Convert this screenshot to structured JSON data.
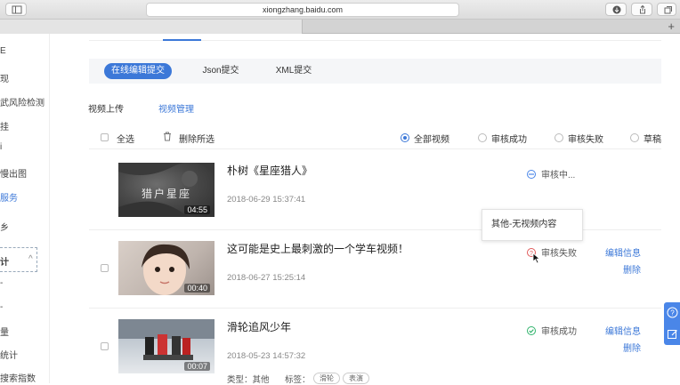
{
  "browser": {
    "url": "xiongzhang.baidu.com",
    "new_tab": "+"
  },
  "sidebar": {
    "items": [
      {
        "label": "E"
      },
      {
        "label": "现"
      },
      {
        "label": "武风险检测"
      },
      {
        "label": "挂"
      },
      {
        "label": "i"
      },
      {
        "label": "慢出图"
      },
      {
        "label": "服务"
      },
      {
        "label": "乡"
      },
      {
        "label": "计"
      },
      {
        "label": "-"
      },
      {
        "label": "-"
      },
      {
        "label": "量"
      },
      {
        "label": "统计"
      },
      {
        "label": "搜索指数"
      }
    ],
    "group_toggle": "^"
  },
  "submit_tabs": [
    {
      "label": "在线编辑提交"
    },
    {
      "label": "Json提交"
    },
    {
      "label": "XML提交"
    }
  ],
  "nav": {
    "upload": "视频上传",
    "manage": "视频管理"
  },
  "filter": {
    "select_all": "全选",
    "delete_selected": "删除所选",
    "options": [
      {
        "label": "全部视频",
        "selected": true
      },
      {
        "label": "审核成功",
        "selected": false
      },
      {
        "label": "审核失败",
        "selected": false
      },
      {
        "label": "草稿",
        "selected": false
      }
    ]
  },
  "videos": [
    {
      "title": "朴树《星座猎人》",
      "date": "2018-06-29 15:37:41",
      "duration": "04:55",
      "thumb_text": "猎户星座",
      "status": "审核中...",
      "status_color": "#4a86e8",
      "actions": []
    },
    {
      "title": "这可能是史上最刺激的一个学车视频！",
      "date": "2018-06-27 15:25:14",
      "duration": "00:40",
      "status": "审核失败",
      "status_color": "#e05a5a",
      "actions": [
        {
          "label": "编辑信息"
        },
        {
          "label": "删除"
        }
      ]
    },
    {
      "title": "滑轮追风少年",
      "date": "2018-05-23 14:57:32",
      "duration": "00:07",
      "status": "审核成功",
      "status_color": "#2fb36b",
      "actions": [
        {
          "label": "编辑信息"
        },
        {
          "label": "删除"
        }
      ],
      "type_label": "类型：其他",
      "tags_label": "标签：",
      "tags": [
        "滑轮",
        "表演"
      ]
    }
  ],
  "tooltip": "其他-无视频内容",
  "colors": {
    "accent": "#3c78d8"
  }
}
